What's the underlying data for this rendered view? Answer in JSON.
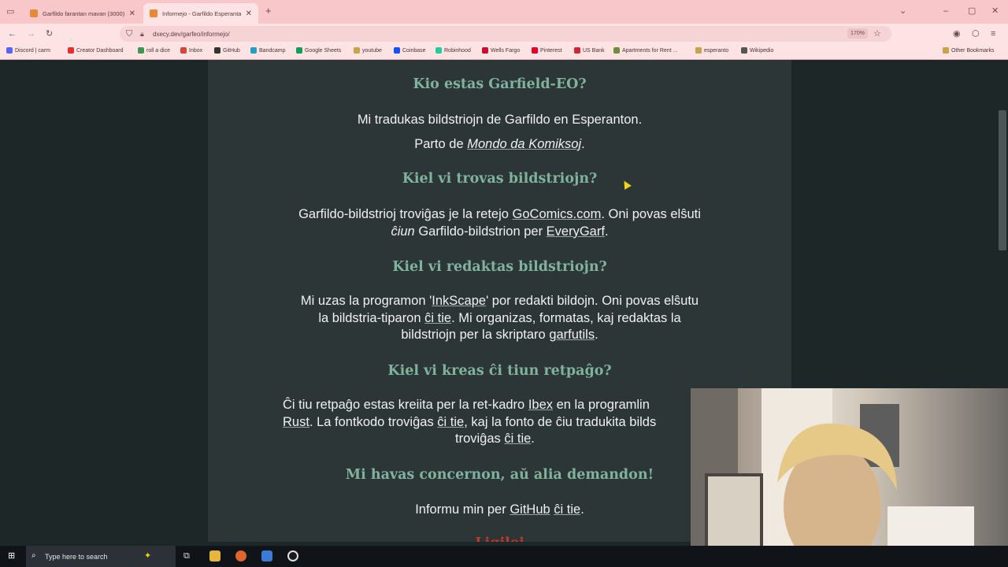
{
  "browser": {
    "tabs": [
      {
        "title": "Garfildo farantan mavan (3000)"
      },
      {
        "title": "Informejo - Garfildo Esperanta"
      }
    ],
    "new_tab_symbol": "+",
    "url": "dxecy.dev/garfeo/informejo/",
    "zoom": "170%"
  },
  "bookmarks": [
    {
      "label": "Discord | carm",
      "color": "#5865f2"
    },
    {
      "label": "Creator Dashboard",
      "color": "#e03030"
    },
    {
      "label": "roll a dice",
      "color": "#3a9a4a"
    },
    {
      "label": "Inbox",
      "color": "#d44638"
    },
    {
      "label": "GitHub",
      "color": "#333333"
    },
    {
      "label": "Bandcamp",
      "color": "#1da0c3"
    },
    {
      "label": "Google Sheets",
      "color": "#0f9d58"
    },
    {
      "label": "youtube",
      "color": "#c9a24a"
    },
    {
      "label": "Coinbase",
      "color": "#1652f0"
    },
    {
      "label": "Robinhood",
      "color": "#21ce99"
    },
    {
      "label": "Wells Fargo",
      "color": "#c8102e"
    },
    {
      "label": "Pinterest",
      "color": "#e60023"
    },
    {
      "label": "US Bank",
      "color": "#d22630"
    },
    {
      "label": "Apartments for Rent ...",
      "color": "#6b8f3c"
    },
    {
      "label": "esperanto",
      "color": "#c9a24a"
    },
    {
      "label": "Wikipedio",
      "color": "#555555"
    },
    {
      "label": "Other Bookmarks",
      "color": "#c9a24a"
    }
  ],
  "page": {
    "sections": [
      {
        "heading": "Kio estas Garfield-EO?"
      },
      {
        "heading": "Kiel vi trovas bildstriojn?"
      },
      {
        "heading": "Kiel vi redaktas bildstriojn?"
      },
      {
        "heading": "Kiel vi kreas ĉi tiun retpaĝo?"
      },
      {
        "heading": "Mi havas concernon, aŭ alia demandon!"
      }
    ],
    "s1": {
      "line1": "Mi tradukas bildstriojn de Garfildo en Esperanton.",
      "line2_prefix": "Parto de ",
      "line2_link": "Mondo da Komiksoj",
      "line2_suffix": "."
    },
    "s2": {
      "t1": "Garfildo-bildstrioj troviĝas je la retejo ",
      "link1": "GoComics.com",
      "t2": ". Oni povas elŝuti",
      "em": "ĉiun",
      "t3": " Garfildo-bildstrion per ",
      "link2": "EveryGarf",
      "t4": "."
    },
    "s3": {
      "t1": "Mi uzas la programon '",
      "link1": "InkScape",
      "t2": "' por redakti bildojn. Oni povas elŝutu",
      "t3": "la bildstria-tiparon ",
      "link2": "ĉi tie",
      "t4": ". Mi organizas, formatas, kaj redaktas la",
      "t5": "bildstriojn per la skriptaro ",
      "link3": "garfutils",
      "t6": "."
    },
    "s4": {
      "t1": "Ĉi tiu retpaĝo estas kreiita per la ret-kadro ",
      "link1": "Ibex",
      "t2": " en la programlin",
      "link2": "Rust",
      "t3": ". La fontkodo troviĝas ",
      "link3": "ĉi tie",
      "t4": ", kaj la fonto de ĉiu tradukita bilds",
      "t5": "troviĝas ",
      "link4": "ĉi tie",
      "t6": "."
    },
    "s5": {
      "t1": "Informu min per ",
      "link1": "GitHub",
      "t2": " ",
      "link2": "ĉi tie",
      "t3": "."
    },
    "next_heading_partial": "Ligiloj"
  },
  "taskbar": {
    "search_placeholder": "Type here to search"
  }
}
